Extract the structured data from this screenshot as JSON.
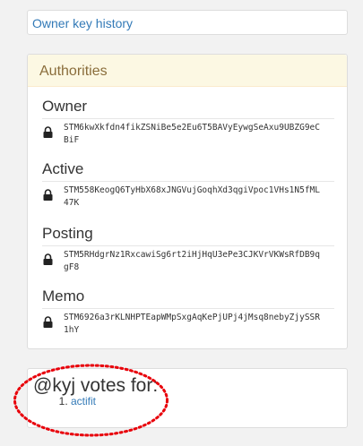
{
  "history": {
    "label": "Owner key history"
  },
  "authorities": {
    "title": "Authorities",
    "items": [
      {
        "label": "Owner",
        "key": "STM6kwXkfdn4fikZSNiBe5e2Eu6T5BAVyEywgSeAxu9UBZG9eCBiF"
      },
      {
        "label": "Active",
        "key": "STM558KeogQ6TyHbX68xJNGVujGoqhXd3qgiVpoc1VHs1N5fML47K"
      },
      {
        "label": "Posting",
        "key": "STM5RHdgrNz1RxcawiSg6rt2iHjHqU3ePe3CJKVrVKWsRfDB9qgF8"
      },
      {
        "label": "Memo",
        "key": "STM6926a3rKLNHPTEapWMpSxgAqKePjUPj4jMsq8nebyZjySSR1hY"
      }
    ]
  },
  "votes": {
    "title": "@kyj votes for:",
    "items": [
      {
        "number": "1.",
        "label": "actifit"
      }
    ]
  },
  "colors": {
    "link": "#337ab7",
    "highlight": "#e8000a",
    "heading_bg": "#fcf8e3"
  },
  "icons": {
    "lock": "lock-icon"
  }
}
